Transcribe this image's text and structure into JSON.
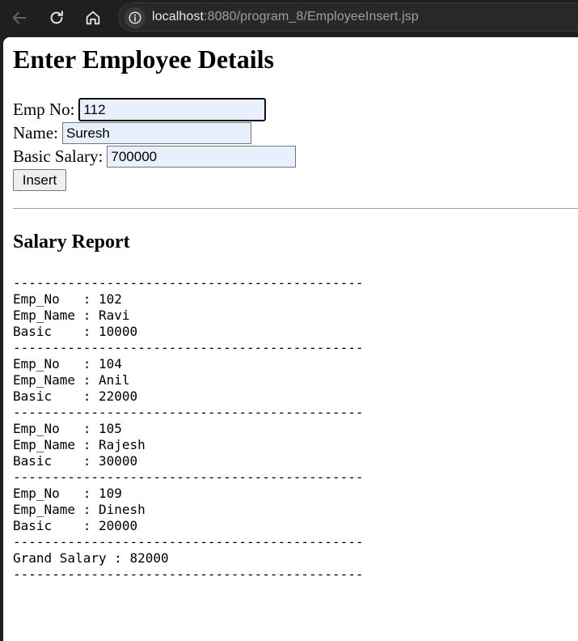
{
  "browser": {
    "url_host": "localhost",
    "url_rest": ":8080/program_8/EmployeeInsert.jsp",
    "icons": [
      "back-arrow-icon",
      "reload-icon",
      "home-icon",
      "site-info-icon"
    ]
  },
  "form": {
    "title": "Enter Employee Details",
    "empno_label": "Emp No:",
    "empno_value": "112",
    "name_label": "Name:",
    "name_value": "Suresh",
    "basic_label": "Basic Salary:",
    "basic_value": "700000",
    "insert_label": "Insert"
  },
  "report": {
    "title": "Salary Report",
    "separator": "---------------------------------------------",
    "fields": {
      "emp_no": "Emp_No   : ",
      "emp_name": "Emp_Name : ",
      "basic": "Basic    : "
    },
    "employees": [
      {
        "emp_no": "102",
        "emp_name": "Ravi",
        "basic": "10000"
      },
      {
        "emp_no": "104",
        "emp_name": "Anil",
        "basic": "22000"
      },
      {
        "emp_no": "105",
        "emp_name": "Rajesh",
        "basic": "30000"
      },
      {
        "emp_no": "109",
        "emp_name": "Dinesh",
        "basic": "20000"
      }
    ],
    "grand_label": "Grand Salary : ",
    "grand_value": "82000"
  },
  "colors": {
    "chrome_bg": "#1f1f1f",
    "omnibox_bg": "#282828",
    "autofill_bg": "#e8f0fe"
  }
}
